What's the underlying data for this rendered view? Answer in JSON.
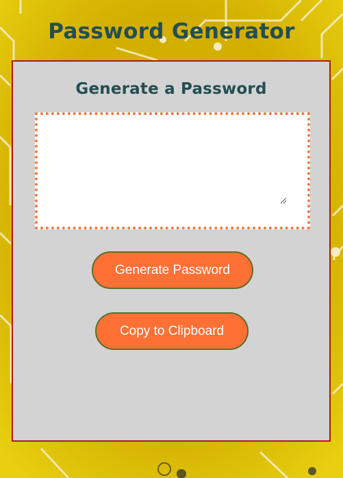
{
  "header": {
    "title": "Password Generator"
  },
  "card": {
    "title": "Generate a Password",
    "password_value": "",
    "password_placeholder": ""
  },
  "buttons": {
    "generate_label": "Generate Password",
    "copy_label": "Copy to Clipboard"
  },
  "colors": {
    "background": "#d4b200",
    "title_text": "#234e52",
    "card_background": "#d3d3d3",
    "card_border": "#b3160c",
    "button_fill": "#ff7035",
    "button_border": "#5a6f2a",
    "textarea_border": "#ee7a45"
  }
}
